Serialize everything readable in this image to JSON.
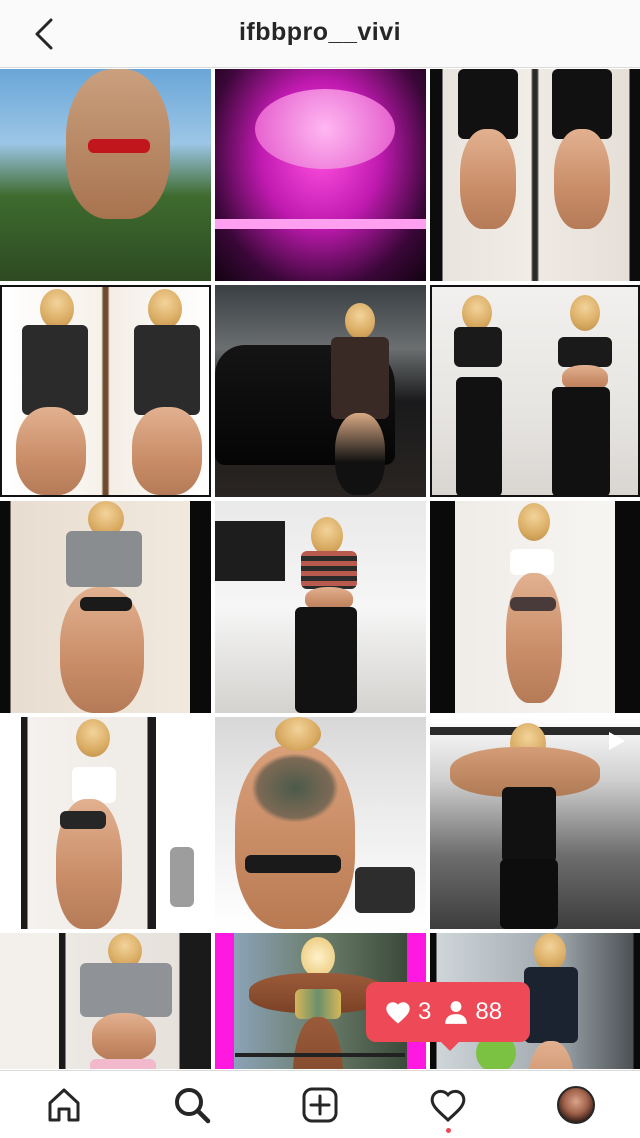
{
  "header": {
    "username": "ifbbpro__vivi",
    "back_icon": "chevron-left-icon"
  },
  "grid": {
    "columns": 3,
    "visible_rows": 5,
    "posts": [
      {
        "index": 1,
        "type": "photo"
      },
      {
        "index": 2,
        "type": "photo"
      },
      {
        "index": 3,
        "type": "photo"
      },
      {
        "index": 4,
        "type": "photo"
      },
      {
        "index": 5,
        "type": "photo"
      },
      {
        "index": 6,
        "type": "photo"
      },
      {
        "index": 7,
        "type": "photo"
      },
      {
        "index": 8,
        "type": "photo"
      },
      {
        "index": 9,
        "type": "photo"
      },
      {
        "index": 10,
        "type": "photo"
      },
      {
        "index": 11,
        "type": "photo"
      },
      {
        "index": 12,
        "type": "video"
      },
      {
        "index": 13,
        "type": "photo"
      },
      {
        "index": 14,
        "type": "photo"
      },
      {
        "index": 15,
        "type": "photo"
      }
    ]
  },
  "activity_popup": {
    "likes": "3",
    "followers": "88",
    "color": "#ed4956"
  },
  "tabbar": {
    "items": [
      "home-icon",
      "search-icon",
      "new-post-icon",
      "activity-heart-icon",
      "profile-avatar"
    ],
    "active": "search-icon",
    "notification_dot_color": "#ed4956"
  }
}
